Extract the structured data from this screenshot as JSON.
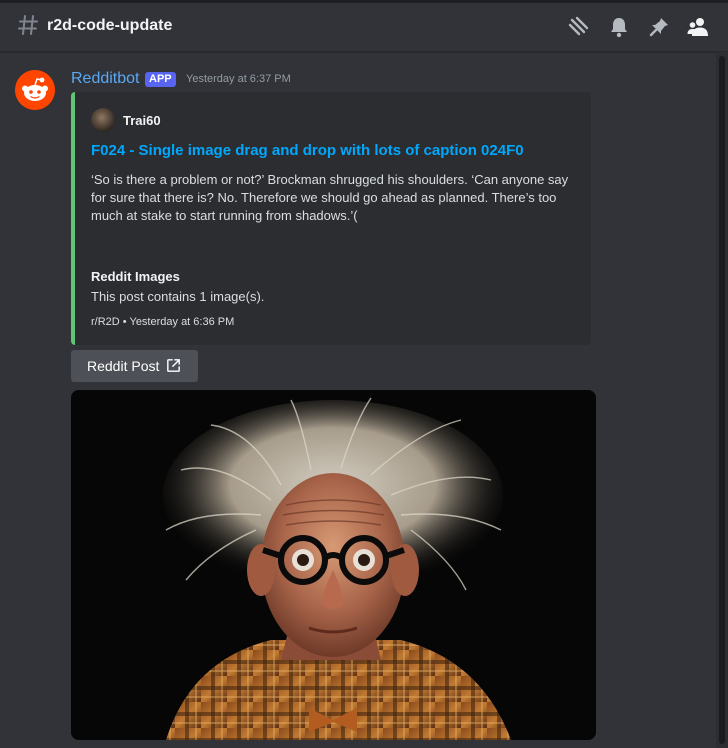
{
  "header": {
    "channel_name": "r2d-code-update",
    "icons": [
      "hash-icon",
      "threads-icon",
      "bell-icon",
      "pin-icon",
      "members-icon"
    ]
  },
  "message": {
    "author": "Redditbot",
    "badge": "APP",
    "timestamp": "Yesterday at 6:37 PM",
    "avatar_icon": "reddit-logo-icon"
  },
  "embed": {
    "accent_color": "#5dc776",
    "author_name": "Trai60",
    "title": "F024 - Single image drag and drop with lots of caption 024F0",
    "description": "‘So is there a problem or not?’ Brockman shrugged his shoulders. ‘Can anyone say for sure that there is? No. Therefore we should go ahead as planned. There’s too much at stake to start running from shadows.’(",
    "field_name": "Reddit Images",
    "field_value": "This post contains 1 image(s).",
    "footer": "r/R2D • Yesterday at 6:36 PM"
  },
  "button": {
    "label": "Reddit Post",
    "icon": "external-link-icon"
  },
  "image": {
    "description": "portrait-elderly-man"
  },
  "colors": {
    "background": "#313338",
    "author": "#5ba8f2",
    "link": "#00a8fc",
    "badge": "#5865f2",
    "reddit": "#ff4500"
  }
}
